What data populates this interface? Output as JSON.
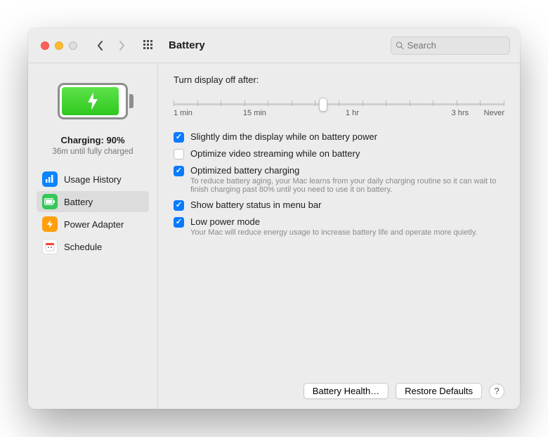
{
  "toolbar": {
    "title": "Battery",
    "search_placeholder": "Search"
  },
  "sidebar": {
    "charging_label": "Charging: 90%",
    "charging_sub": "36m until fully charged",
    "items": [
      {
        "label": "Usage History"
      },
      {
        "label": "Battery"
      },
      {
        "label": "Power Adapter"
      },
      {
        "label": "Schedule"
      }
    ]
  },
  "main": {
    "display_off_label": "Turn display off after:",
    "ticks": [
      "1 min",
      "15 min",
      "1 hr",
      "3 hrs",
      "Never"
    ],
    "options": [
      {
        "checked": true,
        "label": "Slightly dim the display while on battery power",
        "desc": ""
      },
      {
        "checked": false,
        "label": "Optimize video streaming while on battery",
        "desc": ""
      },
      {
        "checked": true,
        "label": "Optimized battery charging",
        "desc": "To reduce battery aging, your Mac learns from your daily charging routine so it can wait to finish charging past 80% until you need to use it on battery."
      },
      {
        "checked": true,
        "label": "Show battery status in menu bar",
        "desc": ""
      },
      {
        "checked": true,
        "label": "Low power mode",
        "desc": "Your Mac will reduce energy usage to increase battery life and operate more quietly."
      }
    ],
    "footer": {
      "battery_health": "Battery Health…",
      "restore_defaults": "Restore Defaults",
      "help": "?"
    }
  }
}
